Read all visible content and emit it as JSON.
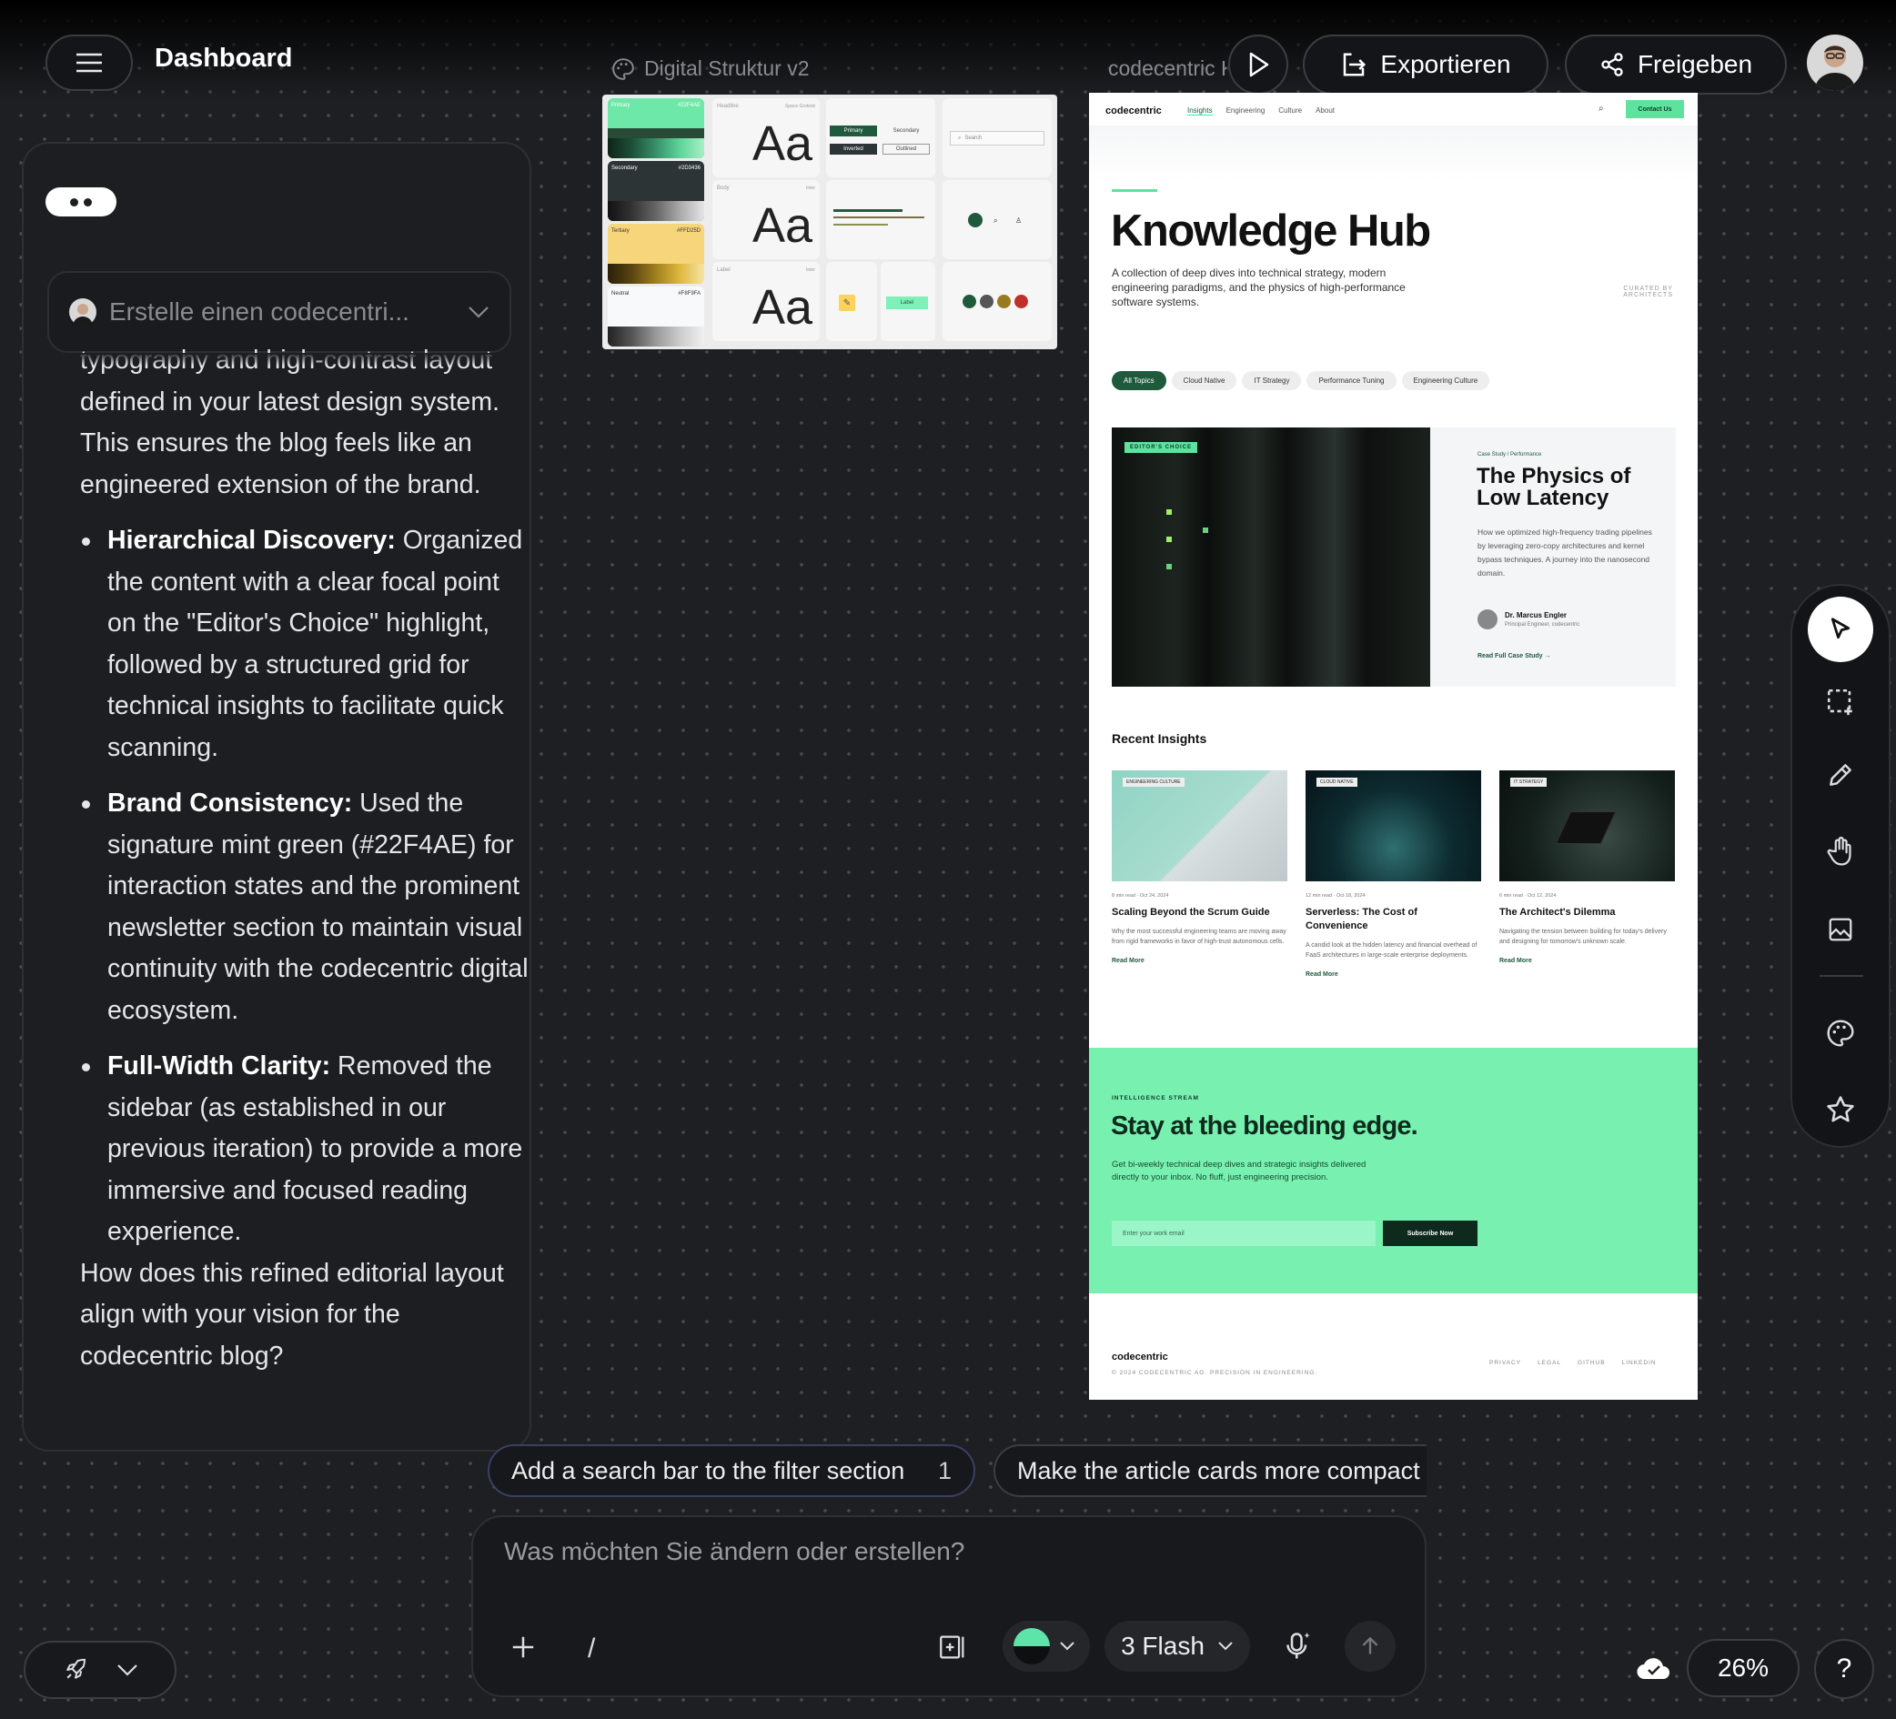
{
  "header": {
    "title": "Dashboard",
    "export_label": "Exportieren",
    "share_label": "Freigeben"
  },
  "chat": {
    "prompt_preview": "Erstelle einen codecentri...",
    "intro": "typography and high-contrast layout defined in your latest design system. This ensures the blog feels like an engineered extension of the brand.",
    "bullets": [
      {
        "title": "Hierarchical Discovery:",
        "text": " Organized the content with a clear focal point on the \"Editor's Choice\" highlight, followed by a structured grid for technical insights to facilitate quick scanning."
      },
      {
        "title": "Brand Consistency:",
        "text": " Used the signature mint green (#22F4AE) for interaction states and the prominent newsletter section to maintain visual continuity with the codecentric digital ecosystem."
      },
      {
        "title": "Full-Width Clarity:",
        "text": " Removed the sidebar (as established in our previous iteration) to provide a more immersive and focused reading experience."
      }
    ],
    "question": "How does this refined editorial layout align with your vision for the codecentric blog?"
  },
  "canvas": {
    "design_system": {
      "label": "Digital Struktur v2",
      "swatches": [
        {
          "name": "Primary",
          "hex": "#22F4AE",
          "color": "#22F4AE",
          "dark": "#1c3a2c"
        },
        {
          "name": "Secondary",
          "hex": "#2D3436",
          "color": "#2D3436",
          "dark": "#1b1e1f"
        },
        {
          "name": "Tertiary",
          "hex": "#FFD25D",
          "color": "#FFD25D",
          "dark": "#3a2e10"
        },
        {
          "name": "Neutral",
          "hex": "#F8F9FA",
          "color": "#F8F9FA",
          "dark": "#2b2b2b"
        }
      ],
      "type_rows": [
        {
          "label": "Headline",
          "meta": "Space Grotesk",
          "sample": "Aa"
        },
        {
          "label": "Body",
          "meta": "Inter",
          "sample": "Aa"
        },
        {
          "label": "Label",
          "meta": "Inter",
          "sample": "Aa"
        }
      ],
      "buttons": {
        "primary": "Primary",
        "secondary": "Secondary",
        "inverted": "Inverted",
        "outlined": "Outlined"
      },
      "search_placeholder": "Search",
      "chip_label": "Label"
    },
    "website": {
      "label": "codecentric Knowl",
      "nav": {
        "brand": "codecentric",
        "links": [
          "Insights",
          "Engineering",
          "Culture",
          "About"
        ],
        "cta": "Contact Us"
      },
      "hero": {
        "title": "Knowledge Hub",
        "desc": "A collection of deep dives into technical strategy, modern engineering paradigms, and the physics of high-performance software systems.",
        "curated": "CURATED BY\nARCHITECTS"
      },
      "filters": [
        "All Topics",
        "Cloud Native",
        "IT Strategy",
        "Performance Tuning",
        "Engineering Culture"
      ],
      "featured": {
        "badge": "EDITOR'S CHOICE",
        "kicker": "Case Study / Performance",
        "title": "The Physics of Low Latency",
        "desc": "How we optimized high-frequency trading pipelines by leveraging zero-copy architectures and kernel bypass techniques. A journey into the nanosecond domain.",
        "author": "Dr. Marcus Engler",
        "role": "Principal Engineer, codecentric",
        "link": "Read Full Case Study"
      },
      "recent_title": "Recent Insights",
      "cards": [
        {
          "tag": "ENGINEERING CULTURE",
          "read": "8 min read",
          "date": "Oct 24, 2024",
          "title": "Scaling Beyond the Scrum Guide",
          "desc": "Why the most successful engineering teams are moving away from rigid frameworks in favor of high-trust autonomous cells.",
          "link": "Read More"
        },
        {
          "tag": "CLOUD NATIVE",
          "read": "12 min read",
          "date": "Oct 18, 2024",
          "title": "Serverless: The Cost of Convenience",
          "desc": "A candid look at the hidden latency and financial overhead of FaaS architectures in large-scale enterprise deployments.",
          "link": "Read More"
        },
        {
          "tag": "IT STRATEGY",
          "read": "6 min read",
          "date": "Oct 12, 2024",
          "title": "The Architect's Dilemma",
          "desc": "Navigating the tension between building for today's delivery and designing for tomorrow's unknown scale.",
          "link": "Read More"
        }
      ],
      "newsletter": {
        "kicker": "INTELLIGENCE STREAM",
        "title": "Stay at the bleeding edge.",
        "desc": "Get bi-weekly technical deep dives and strategic insights delivered directly to your inbox. No fluff, just engineering precision.",
        "placeholder": "Enter your work email",
        "button": "Subscribe Now"
      },
      "footer": {
        "brand": "codecentric",
        "copy": "© 2024 CODECENTRIC AG. PRECISION IN ENGINEERING.",
        "links": [
          "PRIVACY",
          "LEGAL",
          "GITHUB",
          "LINKEDIN"
        ]
      }
    }
  },
  "suggestions": [
    {
      "text": "Add a search bar to the filter section",
      "count": "1"
    },
    {
      "text": "Make the article cards more compact"
    }
  ],
  "composer": {
    "placeholder": "Was möchten Sie ändern oder erstellen?",
    "slash": "/",
    "model": "3 Flash"
  },
  "status": {
    "zoom": "26%",
    "help": "?"
  },
  "colors": {
    "mint": "#22F4AE",
    "newsletter_bg": "#78f0b0",
    "dark_green": "#1f5a3d"
  }
}
